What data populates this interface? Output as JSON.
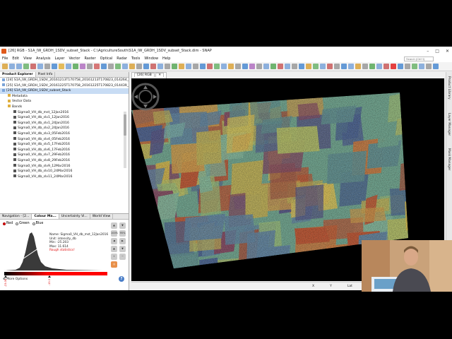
{
  "window": {
    "title": "[26] RGB - S1A_IW_GRDH_1SDV_subset_Stack - C:\\AgricultureSouth\\S1A_IW_GRDH_1SDV_subset_Stack.dim - SNAP",
    "minimize": "–",
    "maximize": "□",
    "close": "✕"
  },
  "menu": [
    "File",
    "Edit",
    "View",
    "Analysis",
    "Layer",
    "Vector",
    "Raster",
    "Optical",
    "Radar",
    "Tools",
    "Window",
    "Help"
  ],
  "search": {
    "placeholder": "Search (Ctrl+I)"
  },
  "left_panel": {
    "tabs": [
      "Product Explorer",
      "Pixel Info"
    ],
    "products": [
      {
        "label": "[24] S1A_IW_GRDH_1SDV_20161213T170758_20161213T170823_014264_0...",
        "level": 0,
        "kind": "product"
      },
      {
        "label": "[25] S1A_IW_GRDH_1SDV_20161225T170758_20161225T170823_014439_0...",
        "level": 0,
        "kind": "product"
      },
      {
        "label": "[26] S1A_IW_GRDH_1SDV_subset_Stack",
        "level": 0,
        "kind": "product",
        "selected": true
      },
      {
        "label": "Metadata",
        "level": 1,
        "kind": "folder"
      },
      {
        "label": "Vector Data",
        "level": 1,
        "kind": "folder"
      },
      {
        "label": "Bands",
        "level": 1,
        "kind": "folder"
      },
      {
        "label": "Sigma0_VH_db_mst_12Jan2016",
        "level": 2,
        "kind": "band"
      },
      {
        "label": "Sigma0_VH_db_slv1_12Jan2016",
        "level": 2,
        "kind": "band"
      },
      {
        "label": "Sigma0_VH_db_slv1_24Jan2016",
        "level": 2,
        "kind": "band"
      },
      {
        "label": "Sigma0_VH_db_slv2_24Jan2016",
        "level": 2,
        "kind": "band"
      },
      {
        "label": "Sigma0_VH_db_slv3_05Feb2016",
        "level": 2,
        "kind": "band"
      },
      {
        "label": "Sigma0_VH_db_slv4_05Feb2016",
        "level": 2,
        "kind": "band"
      },
      {
        "label": "Sigma0_VH_db_slv5_17Feb2016",
        "level": 2,
        "kind": "band"
      },
      {
        "label": "Sigma0_VH_db_slv6_17Feb2016",
        "level": 2,
        "kind": "band"
      },
      {
        "label": "Sigma0_VH_db_slv7_29Feb2016",
        "level": 2,
        "kind": "band"
      },
      {
        "label": "Sigma0_VH_db_slv8_29Feb2016",
        "level": 2,
        "kind": "band"
      },
      {
        "label": "Sigma0_VH_db_slv9_12Mar2016",
        "level": 2,
        "kind": "band"
      },
      {
        "label": "Sigma0_VH_db_slv10_24Mar2016",
        "level": 2,
        "kind": "band"
      },
      {
        "label": "Sigma0_VH_db_slv11_24Mar2016",
        "level": 2,
        "kind": "band"
      }
    ],
    "bottom_tabs": [
      "Navigation - [2...",
      "Colour Ma...",
      "Uncertainty Vi...",
      "World View"
    ],
    "radios": [
      {
        "label": "Red",
        "checked": true
      },
      {
        "label": "Green",
        "checked": false
      },
      {
        "label": "Blue",
        "checked": false
      }
    ],
    "band_info": {
      "name": "Name: Sigma0_VH_db_mst_12Jan2016",
      "unit": "Unit: intensity_db",
      "min": "Min: -25.203",
      "max": "Max: 11.614",
      "warning": "Rough statistics!"
    },
    "slider_labels": [
      "-23.08",
      "-13.3"
    ],
    "more_options": "More Options",
    "help": "?",
    "side_tools": [
      "▲",
      "▼",
      "100%",
      "95%",
      "◀",
      "▶",
      "▲",
      "▼",
      "+",
      "−",
      "◎"
    ]
  },
  "view": {
    "tab_label": "[26] RGB",
    "tab_close": "✕",
    "status": {
      "x": "X",
      "y": "Y",
      "lat": "Lat",
      "lon": "Lon"
    }
  },
  "right_sidebar": [
    "Product Library",
    "Layer Manager",
    "Mask Manager"
  ],
  "colors": {
    "accent": "#e05a1c",
    "selection": "#c8dcf4",
    "warning": "#e01010"
  }
}
